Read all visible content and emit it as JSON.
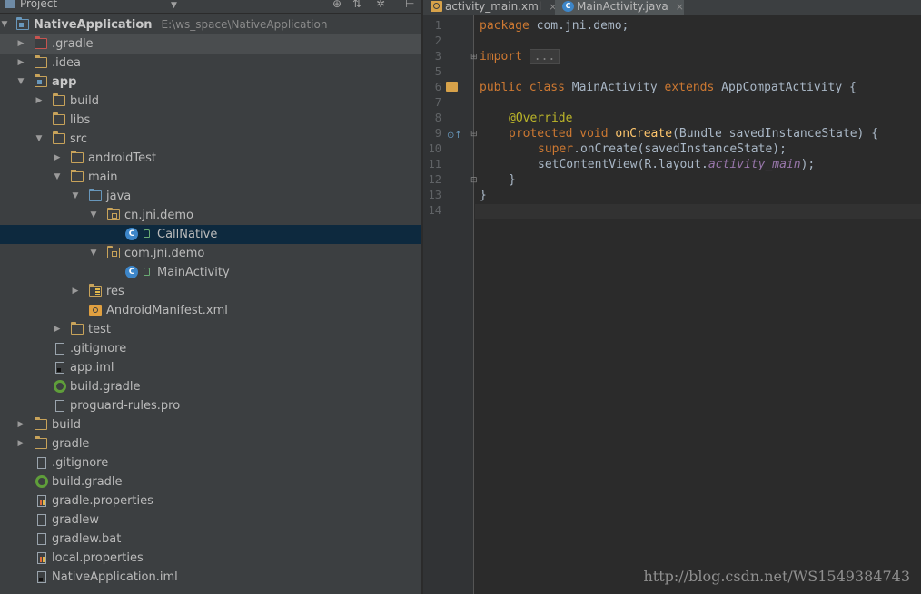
{
  "project_panel": {
    "title": "Project",
    "dropdown_icon": "chevron-down-icon",
    "tools": [
      "target-icon",
      "collapse-icon",
      "gear-icon",
      "hide-icon"
    ]
  },
  "tree": [
    {
      "label": "NativeApplication",
      "extra": "E:\\ws_space\\NativeApplication",
      "bold": true,
      "icon": "module-folder-icon"
    },
    {
      "label": ".gradle",
      "icon": "folder-icon"
    },
    {
      "label": ".idea",
      "icon": "folder-icon"
    },
    {
      "label": "app",
      "bold": true,
      "icon": "module-folder-icon"
    },
    {
      "label": "build",
      "icon": "folder-icon"
    },
    {
      "label": "libs",
      "icon": "folder-icon"
    },
    {
      "label": "src",
      "icon": "folder-icon"
    },
    {
      "label": "androidTest",
      "icon": "folder-icon"
    },
    {
      "label": "main",
      "icon": "folder-icon"
    },
    {
      "label": "java",
      "icon": "source-folder-icon"
    },
    {
      "label": "cn.jni.demo",
      "icon": "package-icon"
    },
    {
      "label": "CallNative",
      "icon": "class-icon",
      "selected": true
    },
    {
      "label": "com.jni.demo",
      "icon": "package-icon"
    },
    {
      "label": "MainActivity",
      "icon": "class-icon"
    },
    {
      "label": "res",
      "icon": "resource-folder-icon"
    },
    {
      "label": "AndroidManifest.xml",
      "icon": "manifest-icon"
    },
    {
      "label": "test",
      "icon": "folder-icon"
    },
    {
      "label": ".gitignore",
      "icon": "file-icon"
    },
    {
      "label": "app.iml",
      "icon": "iml-file-icon"
    },
    {
      "label": "build.gradle",
      "icon": "gradle-icon"
    },
    {
      "label": "proguard-rules.pro",
      "icon": "file-icon"
    },
    {
      "label": "build",
      "icon": "folder-icon"
    },
    {
      "label": "gradle",
      "icon": "folder-icon"
    },
    {
      "label": ".gitignore",
      "icon": "file-icon"
    },
    {
      "label": "build.gradle",
      "icon": "gradle-icon"
    },
    {
      "label": "gradle.properties",
      "icon": "properties-file-icon"
    },
    {
      "label": "gradlew",
      "icon": "file-icon"
    },
    {
      "label": "gradlew.bat",
      "icon": "file-icon"
    },
    {
      "label": "local.properties",
      "icon": "properties-file-icon"
    },
    {
      "label": "NativeApplication.iml",
      "icon": "iml-file-icon"
    }
  ],
  "tabs": [
    {
      "label": "activity_main.xml",
      "icon": "xml-file-icon",
      "active": false
    },
    {
      "label": "MainActivity.java",
      "icon": "class-icon",
      "active": true
    }
  ],
  "tab_close": "×",
  "editor": {
    "line_numbers": [
      "1",
      "2",
      "3",
      "5",
      "6",
      "7",
      "8",
      "9",
      "10",
      "11",
      "12",
      "13",
      "14"
    ],
    "code": {
      "l1_kw": "package",
      "l1_rest": " com.jni.demo;",
      "l3_kw": "import",
      "l3_fold": "...",
      "l6_kw1": "public",
      "l6_kw2": "class",
      "l6_name": "MainActivity",
      "l6_kw3": "extends",
      "l6_rest": " AppCompatActivity {",
      "l8_ann": "@Override",
      "l9_kw1": "protected",
      "l9_kw2": "void",
      "l9_fn": "onCreate",
      "l9_rest": "(Bundle savedInstanceState) {",
      "l10_kw": "super",
      "l10_rest": ".onCreate(savedInstanceState);",
      "l11_pre": "setContentView(R.layout.",
      "l11_it": "activity_main",
      "l11_post": ");",
      "l12": "}",
      "l13": "}"
    }
  },
  "watermark": "http://blog.csdn.net/WS1549384743"
}
